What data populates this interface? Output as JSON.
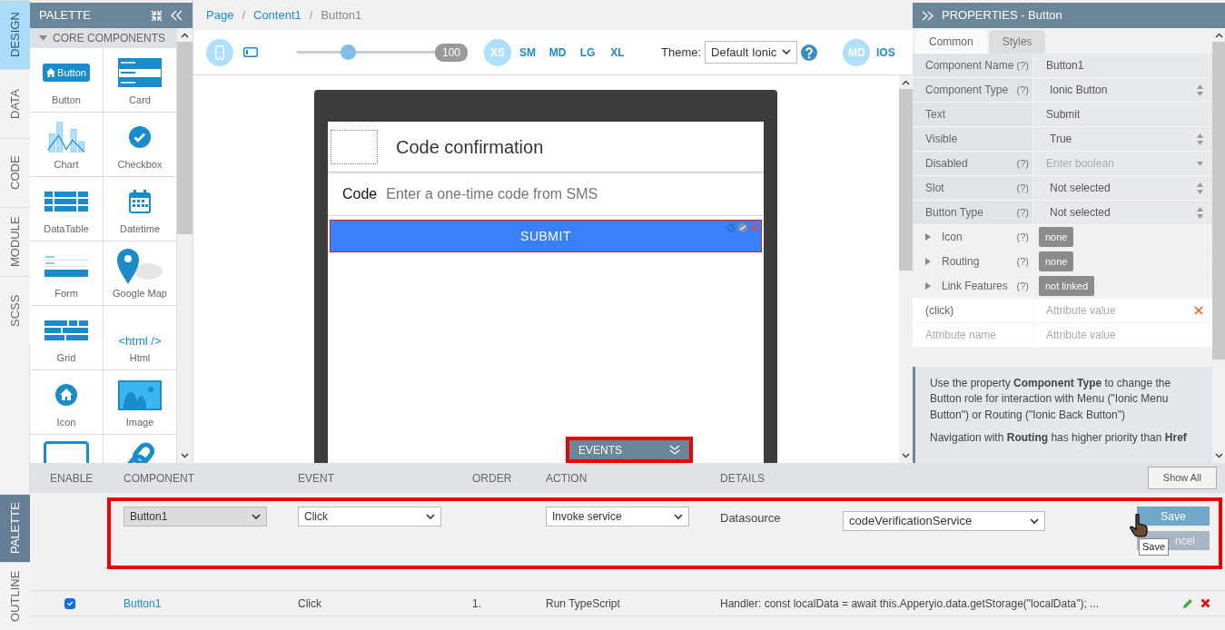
{
  "left_tabs": [
    {
      "label": "DESIGN",
      "selected": true
    },
    {
      "label": "DATA",
      "selected": false
    },
    {
      "label": "CODE",
      "selected": false
    },
    {
      "label": "MODULE",
      "selected": false
    },
    {
      "label": "SCSS",
      "selected": false
    }
  ],
  "bottom_tabs": [
    {
      "label": "PALETTE",
      "selected": true
    },
    {
      "label": "OUTLINE",
      "selected": false
    }
  ],
  "palette": {
    "title": "PALETTE",
    "section": "CORE COMPONENTS",
    "expanded": true,
    "rows": [
      {
        "items": [
          {
            "kind": "button",
            "label": "Button",
            "preview_text": "Button"
          },
          {
            "kind": "card",
            "label": "Card"
          }
        ]
      },
      {
        "items": [
          {
            "kind": "chart",
            "label": "Chart"
          },
          {
            "kind": "checkbox",
            "label": "Checkbox"
          }
        ]
      },
      {
        "items": [
          {
            "kind": "datatable",
            "label": "DataTable"
          },
          {
            "kind": "datetime",
            "label": "Datetime"
          }
        ]
      },
      {
        "items": [
          {
            "kind": "form",
            "label": "Form"
          },
          {
            "kind": "map",
            "label": "Google Map"
          }
        ]
      },
      {
        "items": [
          {
            "kind": "grid",
            "label": "Grid"
          },
          {
            "kind": "html",
            "label": "Html",
            "preview_text": "<html />"
          }
        ]
      },
      {
        "items": [
          {
            "kind": "icon",
            "label": "Icon"
          },
          {
            "kind": "image",
            "label": "Image"
          }
        ]
      },
      {
        "items": [
          {
            "kind": "frame"
          },
          {
            "kind": "link"
          }
        ]
      }
    ]
  },
  "breadcrumb": {
    "separator": "/",
    "items": [
      {
        "label": "Page",
        "current": false
      },
      {
        "label": "Content1",
        "current": false
      },
      {
        "label": "Button1",
        "current": true
      }
    ]
  },
  "toolbar": {
    "devices": [
      {
        "kind": "phone",
        "selected": true
      },
      {
        "kind": "tablet",
        "selected": false
      }
    ],
    "zoom": {
      "level": 0.37,
      "reading": "100"
    },
    "breakpoints": [
      {
        "label": "XS",
        "selected": true
      },
      {
        "label": "SM",
        "selected": false
      },
      {
        "label": "MD",
        "selected": false
      },
      {
        "label": "LG",
        "selected": false
      },
      {
        "label": "XL",
        "selected": false
      }
    ],
    "theme_label": "Theme:",
    "theme_value": "Default Ionic",
    "modes": [
      {
        "label": "MD",
        "selected": true
      },
      {
        "label": "IOS",
        "selected": false
      }
    ]
  },
  "canvas": {
    "page_title": "Code confirmation",
    "field_label": "Code",
    "field_placeholder": "Enter a one-time code from SMS",
    "button_label": "SUBMIT",
    "button_selected": true,
    "events_tab": {
      "label": "EVENTS",
      "highlighted": true
    }
  },
  "properties": {
    "title": "PROPERTIES - Button",
    "tabs": [
      {
        "label": "Common",
        "selected": true
      },
      {
        "label": "Styles",
        "selected": false
      }
    ],
    "rows": [
      {
        "kind": "text",
        "label": "Component Name",
        "help": "(?)",
        "value": "Button1"
      },
      {
        "kind": "select",
        "label": "Component Type",
        "help": "(?)",
        "value": "Ionic Button"
      },
      {
        "kind": "text",
        "label": "Text",
        "value": "Submit"
      },
      {
        "kind": "select",
        "label": "Visible",
        "value": "True"
      },
      {
        "kind": "combo",
        "label": "Disabled",
        "help": "(?)",
        "placeholder": "Enter boolean"
      },
      {
        "kind": "select",
        "label": "Slot",
        "help": "(?)",
        "value": "Not selected"
      },
      {
        "kind": "select",
        "label": "Button Type",
        "help": "(?)",
        "value": "Not selected"
      },
      {
        "kind": "chip",
        "label": "Icon",
        "help": "(?)",
        "value": "none",
        "expanded": false
      },
      {
        "kind": "chip",
        "label": "Routing",
        "help": "(?)",
        "value": "none",
        "expanded": false
      },
      {
        "kind": "chip",
        "label": "Link Features",
        "help": "(?)",
        "value": "not linked",
        "expanded": false
      },
      {
        "kind": "attribute",
        "label": "(click)",
        "placeholder": "Attribute value",
        "removable": true
      },
      {
        "kind": "new-attribute",
        "label_placeholder": "Attribute name",
        "placeholder": "Attribute value"
      }
    ],
    "note": [
      "Use the property **Component Type** to change the Button role for interaction with Menu (\"Ionic Menu Button\") or Routing (\"Ionic Back Button\")",
      "Navigation with **Routing** has higher priority than **Href**"
    ]
  },
  "events": {
    "columns": [
      "ENABLE",
      "COMPONENT",
      "EVENT",
      "ORDER",
      "ACTION",
      "DETAILS"
    ],
    "show_all": "Show All",
    "editor": {
      "highlighted": true,
      "component": "Button1",
      "component_disabled": true,
      "event": "Click",
      "action": "Invoke service",
      "details_label": "Datasource",
      "datasource": "codeVerificationService",
      "save": "Save",
      "cancel": "ncel",
      "tooltip": "Save"
    },
    "rows": [
      {
        "enabled": true,
        "component": "Button1",
        "event": "Click",
        "order": "1.",
        "action": "Run TypeScript",
        "details": "Handler: const localData = await this.Apperyio.data.getStorage(\"localData\"); ..."
      }
    ]
  }
}
